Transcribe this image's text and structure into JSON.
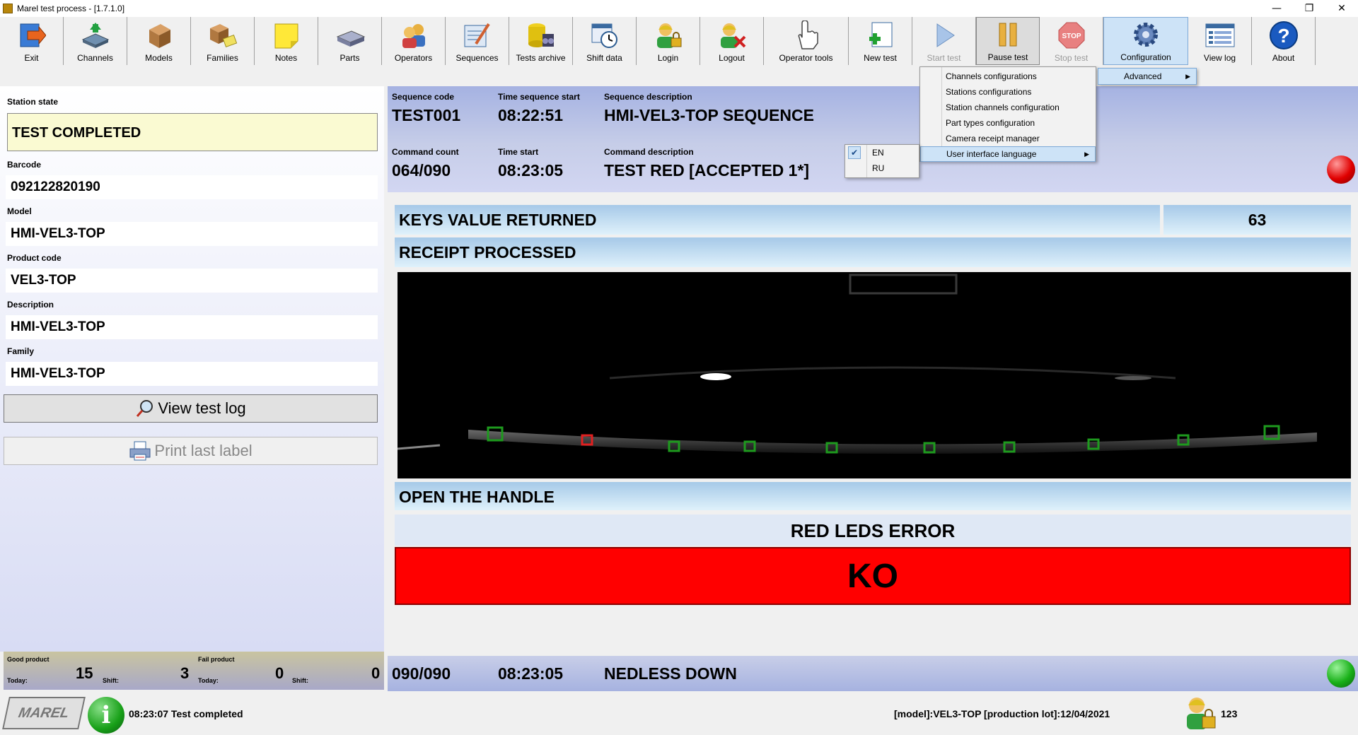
{
  "window": {
    "title": "Marel test process - [1.7.1.0]",
    "minimize": "—",
    "restore": "❐",
    "close": "✕"
  },
  "toolbar": [
    {
      "label": "Exit",
      "icon": "exit-icon"
    },
    {
      "label": "Channels",
      "icon": "channels-icon"
    },
    {
      "label": "Models",
      "icon": "models-box-icon"
    },
    {
      "label": "Families",
      "icon": "families-icon"
    },
    {
      "label": "Notes",
      "icon": "notes-icon"
    },
    {
      "label": "Parts",
      "icon": "parts-icon"
    },
    {
      "label": "Operators",
      "icon": "operators-icon"
    },
    {
      "label": "Sequences",
      "icon": "sequences-icon"
    },
    {
      "label": "Tests archive",
      "icon": "tests-archive-icon"
    },
    {
      "label": "Shift data",
      "icon": "shift-data-icon"
    },
    {
      "label": "Login",
      "icon": "login-icon"
    },
    {
      "label": "Logout",
      "icon": "logout-icon"
    },
    {
      "label": "Operator tools",
      "icon": "operator-tools-icon"
    },
    {
      "label": "New test",
      "icon": "new-test-icon"
    },
    {
      "label": "Start test",
      "icon": "start-test-icon"
    },
    {
      "label": "Pause test",
      "icon": "pause-test-icon"
    },
    {
      "label": "Stop test",
      "icon": "stop-test-icon"
    },
    {
      "label": "Configuration",
      "icon": "configuration-icon"
    },
    {
      "label": "View log",
      "icon": "view-log-icon"
    },
    {
      "label": "About",
      "icon": "about-icon"
    }
  ],
  "station": {
    "state_label": "Station state",
    "state_value": "TEST COMPLETED",
    "barcode_label": "Barcode",
    "barcode_value": "092122820190",
    "model_label": "Model",
    "model_value": "HMI-VEL3-TOP",
    "product_code_label": "Product code",
    "product_code_value": "VEL3-TOP",
    "description_label": "Description",
    "description_value": "HMI-VEL3-TOP",
    "family_label": "Family",
    "family_value": "HMI-VEL3-TOP",
    "view_test_log": "View test log",
    "print_last_label": "Print last label"
  },
  "counters": {
    "good_label": "Good product",
    "fail_label": "Fail product",
    "today_label": "Today:",
    "shift_label": "Shift:",
    "good_today": "15",
    "good_shift": "3",
    "fail_today": "0",
    "fail_shift": "0"
  },
  "sequence": {
    "code_label": "Sequence code",
    "code_value": "TEST001",
    "time_start_label": "Time sequence start",
    "time_start_value": "08:22:51",
    "desc_label": "Sequence description",
    "desc_value": "HMI-VEL3-TOP SEQUENCE",
    "cmd_count_label": "Command count",
    "cmd_count_value": "064/090",
    "cmd_time_label": "Time start",
    "cmd_time_value": "08:23:05",
    "cmd_desc_label": "Command description",
    "cmd_desc_value": "TEST RED [ACCEPTED 1*]"
  },
  "results": {
    "keys_label": "KEYS VALUE RETURNED",
    "keys_value": "63",
    "receipt": "RECEIPT PROCESSED",
    "open_handle": "OPEN THE HANDLE",
    "error": "RED LEDS ERROR",
    "verdict": "KO"
  },
  "last_command": {
    "count": "090/090",
    "time": "08:23:05",
    "description": "NEDLESS DOWN"
  },
  "status": {
    "logo": "MAREL",
    "message": "08:23:07 Test completed",
    "lot_info": "[model]:VEL3-TOP [production lot]:12/04/2021",
    "operator_id": "123"
  },
  "config_menu": {
    "items": [
      "Channels configurations",
      "Stations configurations",
      "Station channels configuration",
      "Part types configuration",
      "Camera receipt manager",
      "User interface language"
    ],
    "advanced": "Advanced"
  },
  "lang_menu": {
    "items": [
      "EN",
      "RU"
    ],
    "selected": "EN"
  },
  "colors": {
    "ko": "#ff0000",
    "led_red": "#e00000",
    "led_green": "#18b018",
    "state_bg": "#fafad2"
  }
}
